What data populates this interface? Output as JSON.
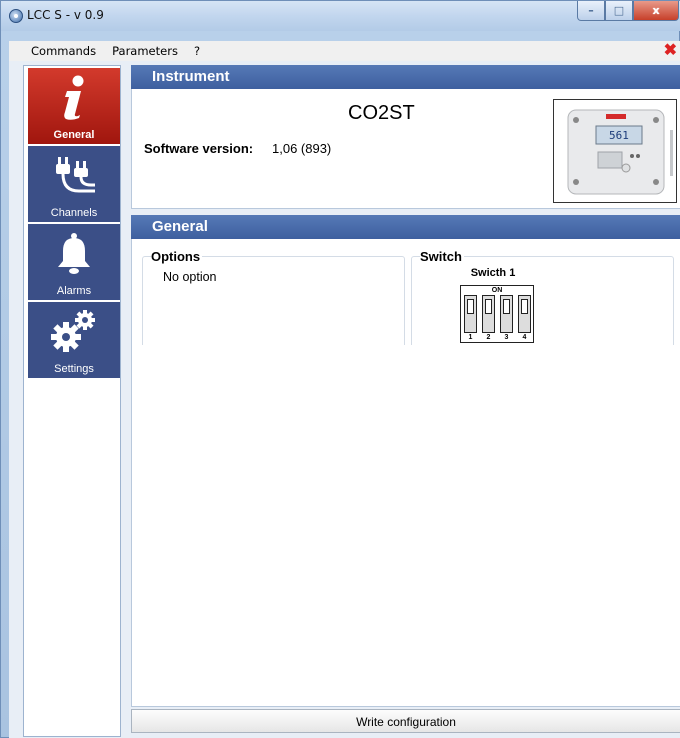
{
  "window": {
    "title": "LCC S - v 0.9",
    "min_glyph": "–",
    "max_glyph": "□",
    "close_glyph": "x"
  },
  "menu": {
    "items": [
      "Commands",
      "Parameters",
      "?"
    ],
    "close_glyph": "✖"
  },
  "sidebar": {
    "items": [
      {
        "label": "General",
        "icon": "info-icon",
        "active": true
      },
      {
        "label": "Channels",
        "icon": "plugs-icon",
        "active": false
      },
      {
        "label": "Alarms",
        "icon": "bell-icon",
        "active": false
      },
      {
        "label": "Settings",
        "icon": "gears-icon",
        "active": false
      }
    ]
  },
  "instrument": {
    "header": "Instrument",
    "name": "CO2ST",
    "software_label": "Software version:",
    "software_value": "1,06 (893)",
    "display_reading": "561"
  },
  "general": {
    "header": "General",
    "options_title": "Options",
    "options_value": "No option",
    "switch_group_title": "Switch",
    "switch_name": "Swicth 1",
    "switch_on_label": "ON",
    "switch_numbers": [
      "1",
      "2",
      "3",
      "4"
    ]
  },
  "actions": {
    "write_label": "Write configuration"
  },
  "colors": {
    "active_tab": "#c2291c",
    "tab": "#3b4f87",
    "header": "#4a6cab"
  }
}
